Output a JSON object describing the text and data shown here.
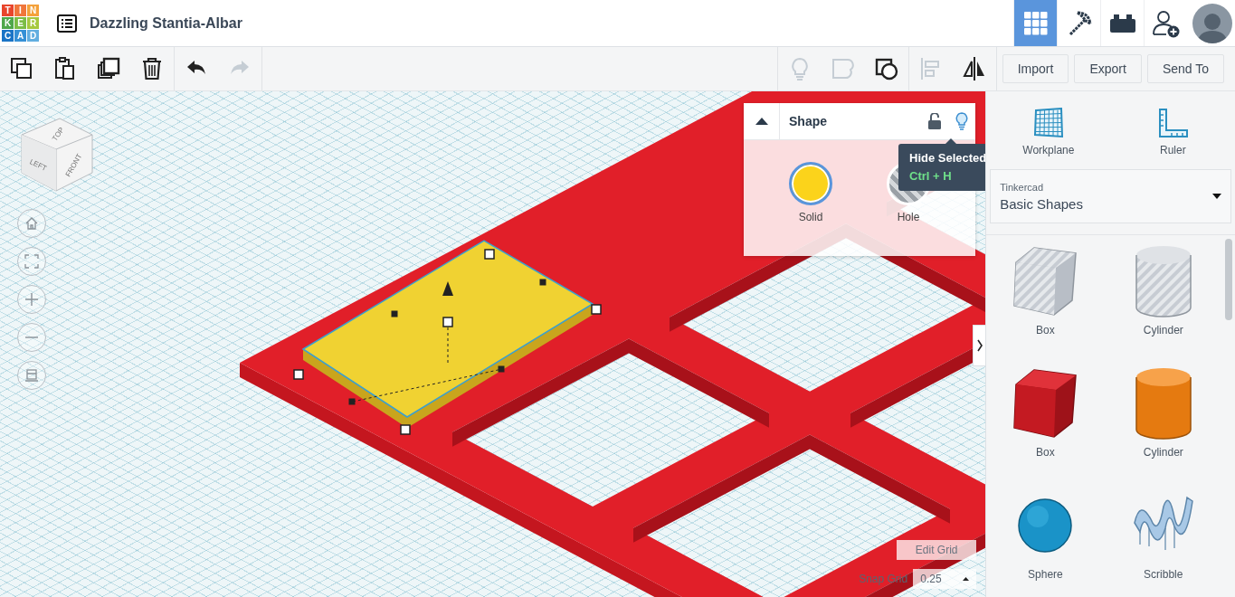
{
  "logo": {
    "letters": [
      {
        "text": "T",
        "color": "#e8452c"
      },
      {
        "text": "I",
        "color": "#f0763b"
      },
      {
        "text": "N",
        "color": "#f4a13a"
      },
      {
        "text": "K",
        "color": "#4fa74a"
      },
      {
        "text": "E",
        "color": "#7bbd45"
      },
      {
        "text": "R",
        "color": "#a6c83f"
      },
      {
        "text": "C",
        "color": "#1a74c6"
      },
      {
        "text": "A",
        "color": "#3590d6"
      },
      {
        "text": "D",
        "color": "#62aee0"
      }
    ]
  },
  "window": {
    "title": "Dazzling Stantia-Albar"
  },
  "header_nav": [
    {
      "kind": "grid",
      "selected": true
    },
    {
      "kind": "pickaxe",
      "selected": false
    },
    {
      "kind": "bricks",
      "selected": false
    },
    {
      "kind": "user-add",
      "selected": false
    }
  ],
  "toolbar": {
    "left": [
      {
        "kind": "copy",
        "disabled": false
      },
      {
        "kind": "paste",
        "disabled": false
      },
      {
        "kind": "duplicate",
        "disabled": false
      },
      {
        "kind": "delete",
        "disabled": false
      },
      {
        "kind": "undo",
        "disabled": false
      },
      {
        "kind": "redo",
        "disabled": true
      }
    ],
    "right": [
      {
        "kind": "bulb",
        "disabled": true
      },
      {
        "kind": "group",
        "disabled": true
      },
      {
        "kind": "ungroup",
        "disabled": false
      },
      {
        "kind": "align",
        "disabled": true
      },
      {
        "kind": "mirror",
        "disabled": false
      }
    ],
    "buttons": [
      "Import",
      "Export",
      "Send To"
    ]
  },
  "view_cube": {
    "top": "TOP",
    "left": "LEFT",
    "front": "FRONT"
  },
  "shape_panel": {
    "title": "Shape",
    "options": [
      {
        "label": "Solid",
        "kind": "solid",
        "selected": true
      },
      {
        "label": "Hole",
        "kind": "hole",
        "selected": false
      }
    ],
    "tooltip": {
      "title": "Hide Selected",
      "shortcut": "Ctrl + H"
    }
  },
  "grid_controls": {
    "edit_button": "Edit Grid",
    "snap_label": "Snap Grid",
    "snap_value": "0.25"
  },
  "sidebar": {
    "tools": [
      {
        "label": "Workplane",
        "kind": "workplane"
      },
      {
        "label": "Ruler",
        "kind": "ruler"
      }
    ],
    "library": {
      "caption": "Tinkercad",
      "value": "Basic Shapes"
    },
    "shapes": [
      {
        "label": "Box",
        "kind": "hole-box"
      },
      {
        "label": "Cylinder",
        "kind": "hole-cylinder"
      },
      {
        "label": "Box",
        "kind": "box"
      },
      {
        "label": "Cylinder",
        "kind": "cylinder"
      },
      {
        "label": "Sphere",
        "kind": "sphere"
      },
      {
        "label": "Scribble",
        "kind": "scribble"
      }
    ]
  }
}
